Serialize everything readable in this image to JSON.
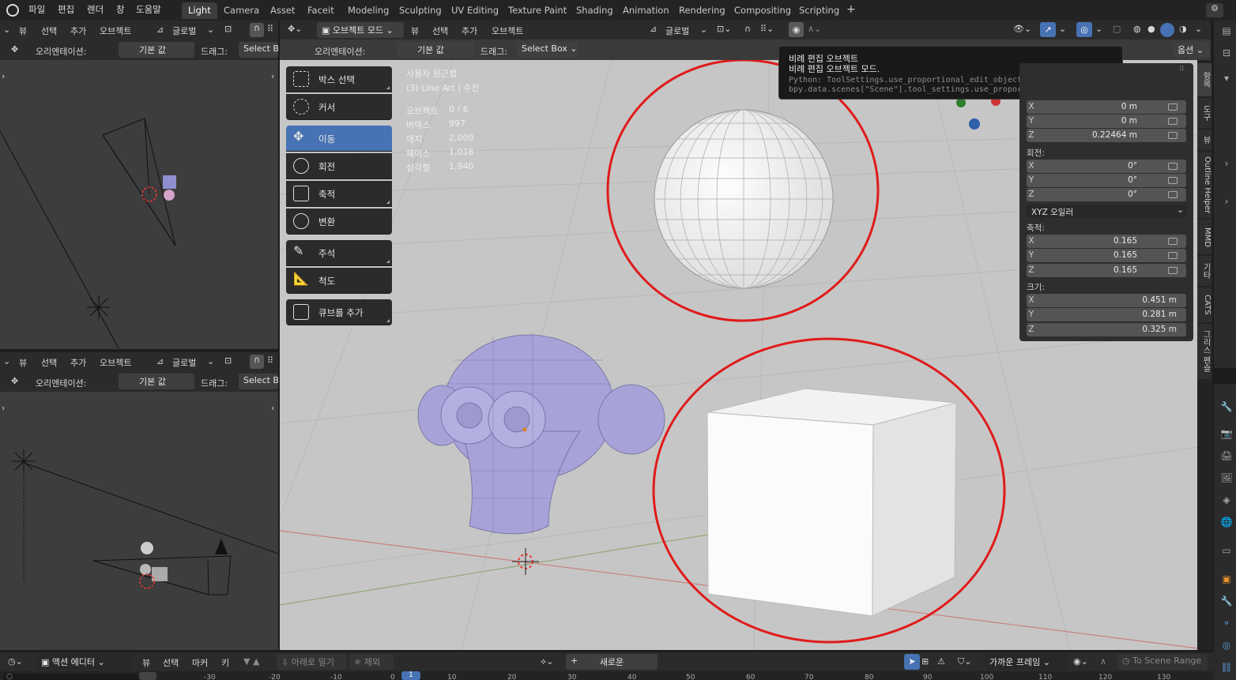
{
  "topbar": {
    "menus": [
      "파일",
      "편집",
      "렌더",
      "창",
      "도움말"
    ],
    "workspaces": [
      "Light",
      "Camera",
      "Asset",
      "Faceit",
      "Modeling",
      "Sculpting",
      "UV Editing",
      "Texture Paint",
      "Shading",
      "Animation",
      "Rendering",
      "Compositing",
      "Scripting"
    ],
    "add_tab": "+"
  },
  "left_top": {
    "menus": [
      "뷰",
      "선택",
      "추가",
      "오브젝트"
    ],
    "orientation_btn": "글로벌",
    "orient_label": "오리엔테이션:",
    "orient_value": "기본 값",
    "drag_label": "드래그:",
    "drag_value": "Select Box"
  },
  "left_bottom": {
    "menus": [
      "뷰",
      "선택",
      "추가",
      "오브젝트"
    ],
    "orientation_btn": "글로벌",
    "orient_label": "오리엔테이션:",
    "orient_value": "기본 값",
    "drag_label": "드래그:",
    "drag_value": "Select Box"
  },
  "main_header": {
    "mode": "오브젝트 모드",
    "menus": [
      "뷰",
      "선택",
      "추가",
      "오브젝트"
    ],
    "orientation_btn": "글로벌",
    "orient_label": "오리엔테이션:",
    "orient_value": "기본 값",
    "drag_label": "드래그:",
    "drag_value": "Select Box",
    "options": "옵션"
  },
  "toolbar": {
    "tools": [
      "박스 선택",
      "커서",
      "이동",
      "회전",
      "축적",
      "변환",
      "주석",
      "척도",
      "큐브를 추가"
    ],
    "active_index": 2
  },
  "overlay": {
    "view_name": "사용자 원근법",
    "collection": "(3) Line Art | 수잔",
    "stats": [
      {
        "label": "오브젝트",
        "value": "0 / 6"
      },
      {
        "label": "버텍스",
        "value": "997"
      },
      {
        "label": "에지",
        "value": "2,009"
      },
      {
        "label": "페이스",
        "value": "1,018"
      },
      {
        "label": "삼각형",
        "value": "1,940"
      }
    ]
  },
  "tooltip": {
    "title": "비례 편집 오브젝트",
    "desc": "비례 편집 오브젝트 모드.",
    "python": "Python: ToolSettings.use_proportional_edit_objects",
    "data": "bpy.data.scenes[\"Scene\"].tool_settings.use_proportional_edit_objects"
  },
  "npanel": {
    "location": [
      {
        "axis": "X",
        "value": "0 m"
      },
      {
        "axis": "Y",
        "value": "0 m"
      },
      {
        "axis": "Z",
        "value": "0.22464 m"
      }
    ],
    "rotation_label": "회전:",
    "rotation": [
      {
        "axis": "X",
        "value": "0°"
      },
      {
        "axis": "Y",
        "value": "0°"
      },
      {
        "axis": "Z",
        "value": "0°"
      }
    ],
    "rotation_mode": "XYZ 오일러",
    "scale_label": "축적:",
    "scale": [
      {
        "axis": "X",
        "value": "0.165"
      },
      {
        "axis": "Y",
        "value": "0.165"
      },
      {
        "axis": "Z",
        "value": "0.165"
      }
    ],
    "dimensions_label": "크기:",
    "dimensions": [
      {
        "axis": "X",
        "value": "0.451 m"
      },
      {
        "axis": "Y",
        "value": "0.281 m"
      },
      {
        "axis": "Z",
        "value": "0.325 m"
      }
    ]
  },
  "side_tabs": [
    "항목",
    "도구",
    "뷰",
    "Outline Helper",
    "MMD",
    "기타",
    "CATS",
    "그리스 펜슬"
  ],
  "timeline": {
    "editor": "액션 에디터",
    "menus": [
      "뷰",
      "선택",
      "마커",
      "키"
    ],
    "push_down": "아래로 밀기",
    "stash": "제외",
    "new_btn": "새로운",
    "snap_mode": "가까운 프레임",
    "scene_range": "To Scene Range",
    "ruler": [
      "-30",
      "-20",
      "-10",
      "0",
      "1",
      "10",
      "20",
      "30",
      "40",
      "50",
      "60",
      "70",
      "80",
      "90",
      "100",
      "110",
      "120",
      "130"
    ]
  },
  "colors": {
    "accent": "#4772b3",
    "highlight_circle": "#e01b1b",
    "viewport_bg": "#c8c8c8",
    "suzanne": "#a7a3d8"
  }
}
